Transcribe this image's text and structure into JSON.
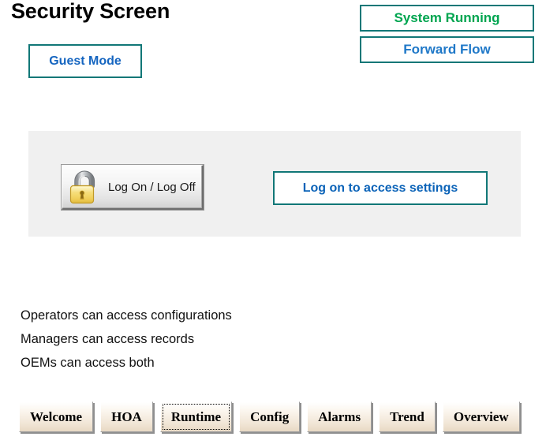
{
  "page": {
    "title": "Security Screen"
  },
  "mode": {
    "label": "Guest Mode"
  },
  "status": {
    "system": "System Running",
    "flow": "Forward Flow",
    "system_color": "#00a550",
    "flow_color": "#1f78c8",
    "border_color": "#117777"
  },
  "panel": {
    "lock_button_label": "Log On / Log Off",
    "lock_icon": "open-padlock-icon",
    "login_hint": "Log on to access settings",
    "background_color": "#f0f0f0"
  },
  "info": {
    "lines": [
      "Operators can access configurations",
      "Managers can access records",
      "OEMs can access both"
    ]
  },
  "navigation": {
    "tabs": [
      {
        "label": "Welcome",
        "selected": false
      },
      {
        "label": "HOA",
        "selected": false
      },
      {
        "label": "Runtime",
        "selected": true
      },
      {
        "label": "Config",
        "selected": false
      },
      {
        "label": "Alarms",
        "selected": false
      },
      {
        "label": "Trend",
        "selected": false
      },
      {
        "label": "Overview",
        "selected": false
      }
    ]
  }
}
